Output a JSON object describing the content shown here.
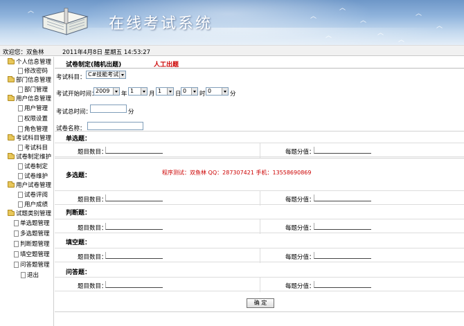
{
  "app": {
    "title": "在线考试系统"
  },
  "status": {
    "welcome": "欢迎您：双鱼林",
    "datetime": "2011年4月8日 星期五  14:53:27"
  },
  "sidebar": {
    "items": [
      {
        "label": "个人信息管理",
        "type": "folder"
      },
      {
        "label": "修改密码",
        "type": "doc"
      },
      {
        "label": "部门信息管理",
        "type": "folder"
      },
      {
        "label": "部门管理",
        "type": "doc"
      },
      {
        "label": "用户信息管理",
        "type": "folder"
      },
      {
        "label": "用户管理",
        "type": "doc"
      },
      {
        "label": "权限设置",
        "type": "doc"
      },
      {
        "label": "角色管理",
        "type": "doc"
      },
      {
        "label": "考试科目管理",
        "type": "folder"
      },
      {
        "label": "考试科目",
        "type": "doc"
      },
      {
        "label": "试卷制定维护",
        "type": "folder"
      },
      {
        "label": "试卷制定",
        "type": "doc"
      },
      {
        "label": "试卷维护",
        "type": "doc"
      },
      {
        "label": "用户试卷管理",
        "type": "folder"
      },
      {
        "label": "试卷评阅",
        "type": "doc"
      },
      {
        "label": "用户成绩",
        "type": "doc"
      },
      {
        "label": "试题类别管理",
        "type": "folder"
      },
      {
        "label": "单选题管理",
        "type": "doc"
      },
      {
        "label": "多选题管理",
        "type": "doc"
      },
      {
        "label": "判断题管理",
        "type": "doc"
      },
      {
        "label": "填空题管理",
        "type": "doc"
      },
      {
        "label": "问答题管理",
        "type": "doc"
      },
      {
        "label": "退出",
        "type": "doc"
      }
    ]
  },
  "main": {
    "heading": "试卷制定(随机出题)",
    "manual_link": "人工出题",
    "subject_label": "考试科目：",
    "subject_value": "C#技能考试",
    "start_label": "考试开始时间：",
    "year_value": "2009",
    "year_unit": "年",
    "month_value": "1",
    "month_unit": "月",
    "day_value": "1",
    "day_unit": "日",
    "hour_value": "0",
    "hour_unit": "时",
    "minute_value": "0",
    "minute_unit": "分",
    "duration_label": "考试总时间：",
    "duration_unit": "分",
    "name_label": "试卷名称：",
    "count_label": "题目数目：",
    "score_label": "每题分值：",
    "sections": [
      "单选题：",
      "多选题：",
      "判断题：",
      "填空题：",
      "问答题："
    ],
    "notice": "程序测试：双鱼林  QQ：287307421  手机：13558690869",
    "submit_label": "确  定"
  }
}
